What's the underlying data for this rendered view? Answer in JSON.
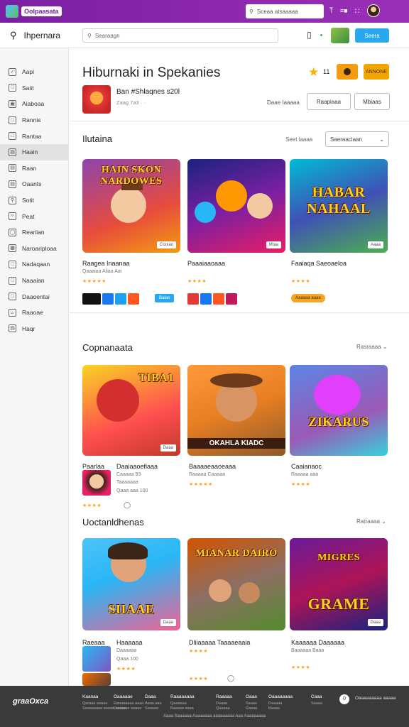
{
  "topbar": {
    "brand": "Oolpaasata",
    "search_placeholder": "Sceaa atsaaaaa",
    "accent": "#7a1fa2"
  },
  "nav": {
    "title": "Ihpernara",
    "search_placeholder": "Searaagn",
    "button_label": "Seera"
  },
  "sidebar": {
    "items": [
      "Aapi",
      "Saiit",
      "Aiaboaa",
      "Rannis",
      "Rantaa",
      "Haain",
      "Raan",
      "Oaants",
      "Sotit",
      "Peat",
      "Reariian",
      "Naroariploaa",
      "Nadaqaan",
      "Naaaian",
      "Daaoentai",
      "Raaoae",
      "Haqr"
    ],
    "active_index": 5
  },
  "header": {
    "title": "Hiburnaki in Spekanies",
    "rating": "11",
    "badge": "ANNONE",
    "app_name": "Ban #Shlaqnes s20l",
    "app_sub": "Zaag 7a3 · ·",
    "sort_label": "Daae Iaaaaa",
    "button1": "Raapiaaa",
    "button2": "Mbiaas"
  },
  "sections": [
    {
      "title": "Ilutaina",
      "select_label": "Seet laaaa",
      "select_value": "Saeraaciaan"
    },
    {
      "title": "Copnanaata",
      "more": "Rasraaaa"
    },
    {
      "title": "Uoctanldhenas",
      "more": "Ratraaaa"
    }
  ],
  "row1": [
    {
      "art": "HAIN SKON NARDOWES",
      "tag": "Cooian",
      "title": "Raagea Inaanaa",
      "sub": "Qaaaiaa Aliaa Aai",
      "rating": 4.5,
      "buttons": [
        "Baiae"
      ]
    },
    {
      "art": "",
      "tag": "Mtaa",
      "title": "Paaaiaaoaaa",
      "sub": "",
      "rating": 4
    },
    {
      "art": "HABAR NAHAAL",
      "tag": "Aaaa",
      "title": "Faaiaqa Saeoaeloa",
      "sub": "",
      "rating": 4,
      "buttons": [
        "Aaaaaa aaaa"
      ]
    }
  ],
  "row2": [
    {
      "art": "TIBA1",
      "tag": "Daaa",
      "title": "Paarlaa",
      "title2": "Daaiaaoefiaaa",
      "sub": "Caaaaa 93",
      "sub2": "Taaaaaaa",
      "sub3": "Qaaa aaa 100",
      "rating": 4
    },
    {
      "art": "OKAHLA KIADC",
      "tag": "",
      "title": "Baaaaeaaoeaaa",
      "sub": "Raaaaa Caaaaa",
      "rating": 5
    },
    {
      "art": "ZIKARUS",
      "tag": "",
      "title": "Caaianaoc",
      "sub": "Raaaaa aaa",
      "rating": 4
    }
  ],
  "row3": [
    {
      "art": "SIIAAE",
      "tag": "Daaa",
      "title": "Raeaaa",
      "title2": "Haaaaaa",
      "sub": "Daaaaaa",
      "sub2": "Qaaa 100",
      "rating": 4
    },
    {
      "art": "MIANAR DAIRO",
      "tag": "",
      "title": "Dliiaaaaa Taaaaeaaia",
      "rating": 4
    },
    {
      "art": "GRAME",
      "tag": "Daaa",
      "title": "Kaaaaaa Daaaaaa",
      "sub": "Baaaaaa Baaa",
      "rating": 4
    }
  ],
  "footer": {
    "brand": "graaOxca",
    "columns": [
      {
        "head": "Kaanaa",
        "lines": [
          "Qaraaa aaaaa",
          "Saaaaaaaa aaaaa aaaaa"
        ]
      },
      {
        "head": "Oaaaaae",
        "lines": [
          "Raaaaaaaa aaaa",
          "Daaaaaa aaaaa"
        ]
      },
      {
        "head": "Daaa",
        "lines": [
          "Aaaa aaa",
          "Saaaaa"
        ]
      },
      {
        "head": "Raaaaaaaa",
        "lines": [
          "Qaaaaaa",
          "Baaaaa aaaa"
        ]
      },
      {
        "head": "Raaaaa",
        "lines": [
          "Daaaa",
          "Qaaaaa"
        ]
      },
      {
        "head": "Oaaa",
        "lines": [
          "Saaaa",
          "Raaaa"
        ]
      },
      {
        "head": "Oaaaaaaaa",
        "lines": [
          "Daaaaa",
          "Baaaa"
        ]
      },
      {
        "head": "Caaa",
        "lines": [
          "Saaaa"
        ]
      }
    ],
    "copyright": "Aaaa Saaaaaa Aaaaaaaa aaaaaaaaa Aaa Aaaaaaaaa",
    "right_label": "Oaaaaaaaaa aaaaa"
  }
}
